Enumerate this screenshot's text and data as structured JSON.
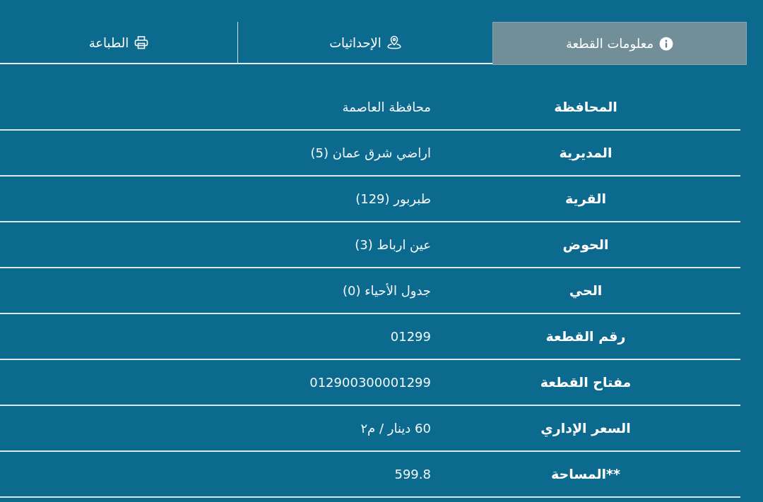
{
  "tabs": [
    {
      "label": "معلومات القطعة",
      "selected": true
    },
    {
      "label": "الإحداثيات",
      "selected": false
    },
    {
      "label": "الطباعة",
      "selected": false
    }
  ],
  "rows": [
    {
      "label": "المحافظة",
      "value": "محافظة العاصمة"
    },
    {
      "label": "المديرية",
      "value": "اراضي شرق عمان (5)"
    },
    {
      "label": "القرية",
      "value": "طبربور (129)"
    },
    {
      "label": "الحوض",
      "value": "عين ارباط (3)"
    },
    {
      "label": "الحي",
      "value": "جدول الأحياء (0)"
    },
    {
      "label": "رقم القطعة",
      "value": "01299"
    },
    {
      "label": "مفتاح القطعة",
      "value": "012900300001299"
    },
    {
      "label": "السعر الإداري",
      "value": "60 دينار / م٢"
    },
    {
      "label": "**المساحة",
      "value": "599.8"
    }
  ]
}
